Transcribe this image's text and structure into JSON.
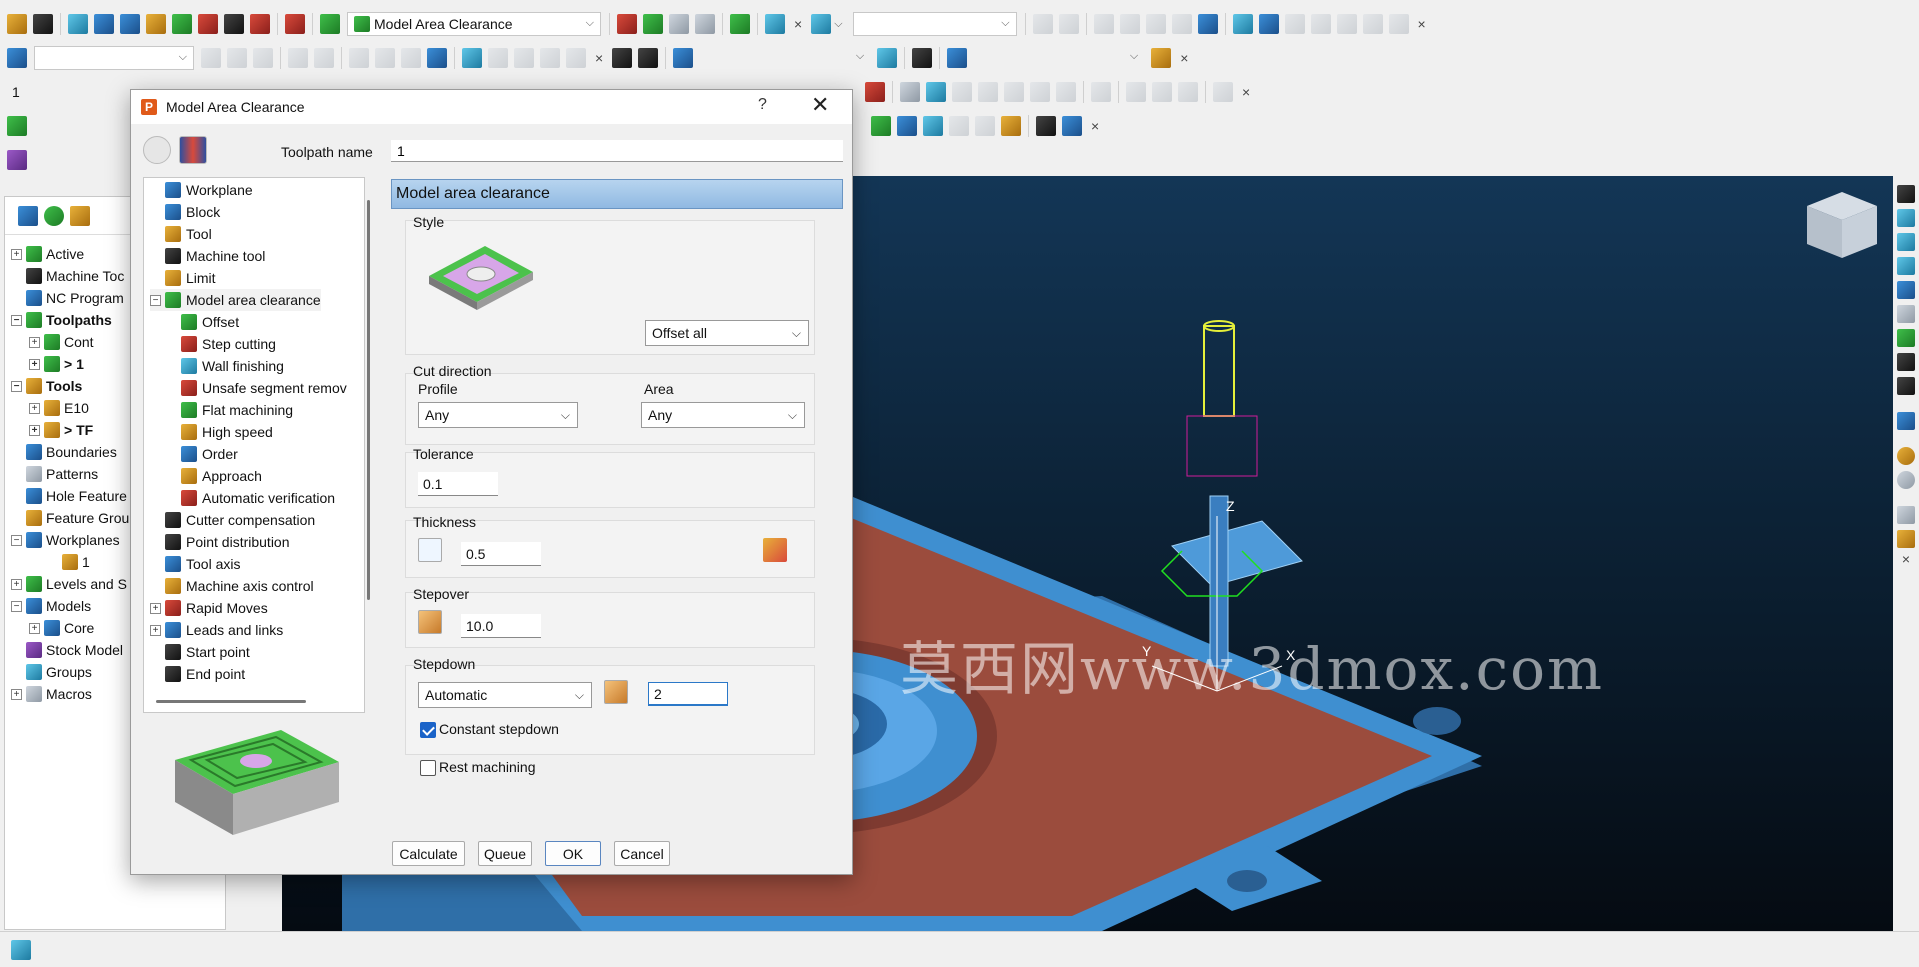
{
  "toolbar": {
    "strategy_combo": "Model Area Clearance",
    "row3_field": "1",
    "close_glyph": "×"
  },
  "explorer": {
    "items": [
      {
        "label": "Active",
        "bold": false
      },
      {
        "label": "Machine Toc",
        "bold": false
      },
      {
        "label": "NC Program",
        "bold": false
      },
      {
        "label": "Toolpaths",
        "bold": true
      },
      {
        "label": "Cont",
        "bold": false
      },
      {
        "label": "> 1",
        "bold": true
      },
      {
        "label": "Tools",
        "bold": true
      },
      {
        "label": "E10",
        "bold": false
      },
      {
        "label": "> TF",
        "bold": true
      },
      {
        "label": "Boundaries",
        "bold": false
      },
      {
        "label": "Patterns",
        "bold": false
      },
      {
        "label": "Hole Feature",
        "bold": false
      },
      {
        "label": "Feature Grou",
        "bold": false
      },
      {
        "label": "Workplanes",
        "bold": false
      },
      {
        "label": "1",
        "bold": false
      },
      {
        "label": "Levels and S",
        "bold": false
      },
      {
        "label": "Models",
        "bold": false
      },
      {
        "label": "Core",
        "bold": false
      },
      {
        "label": "Stock Model",
        "bold": false
      },
      {
        "label": "Groups",
        "bold": false
      },
      {
        "label": "Macros",
        "bold": false
      }
    ]
  },
  "watermark": "莫西网www.3dmox.com",
  "dialog": {
    "title": "Model Area Clearance",
    "help": "?",
    "close": "✕",
    "toolpath_name_label": "Toolpath name",
    "toolpath_name_value": "1",
    "page_header": "Model area clearance",
    "tree": [
      {
        "label": "Workplane"
      },
      {
        "label": "Block"
      },
      {
        "label": "Tool"
      },
      {
        "label": "Machine tool"
      },
      {
        "label": "Limit"
      },
      {
        "label": "Model area clearance"
      },
      {
        "label": "Offset"
      },
      {
        "label": "Step cutting"
      },
      {
        "label": "Wall finishing"
      },
      {
        "label": "Unsafe segment remov"
      },
      {
        "label": "Flat machining"
      },
      {
        "label": "High speed"
      },
      {
        "label": "Order"
      },
      {
        "label": "Approach"
      },
      {
        "label": "Automatic verification"
      },
      {
        "label": "Cutter compensation"
      },
      {
        "label": "Point distribution"
      },
      {
        "label": "Tool axis"
      },
      {
        "label": "Machine axis control"
      },
      {
        "label": "Rapid Moves"
      },
      {
        "label": "Leads and links"
      },
      {
        "label": "Start point"
      },
      {
        "label": "End point"
      }
    ],
    "style": {
      "label": "Style",
      "value": "Offset all"
    },
    "cut_direction": {
      "label": "Cut direction",
      "profile_label": "Profile",
      "profile_value": "Any",
      "area_label": "Area",
      "area_value": "Any"
    },
    "tolerance": {
      "label": "Tolerance",
      "value": "0.1"
    },
    "thickness": {
      "label": "Thickness",
      "value": "0.5"
    },
    "stepover": {
      "label": "Stepover",
      "value": "10.0"
    },
    "stepdown": {
      "label": "Stepdown",
      "mode": "Automatic",
      "value": "2",
      "constant_label": "Constant stepdown",
      "constant_checked": true
    },
    "rest_machining": {
      "label": "Rest machining",
      "checked": false
    },
    "buttons": {
      "calculate": "Calculate",
      "queue": "Queue",
      "ok": "OK",
      "cancel": "Cancel"
    }
  },
  "colors": {
    "selection_header": "#a9c9ea",
    "viewport_top": "#133656",
    "part_blue": "#3f8fd0",
    "part_brown": "#a0503f",
    "checkbox_blue": "#1a63c8"
  }
}
